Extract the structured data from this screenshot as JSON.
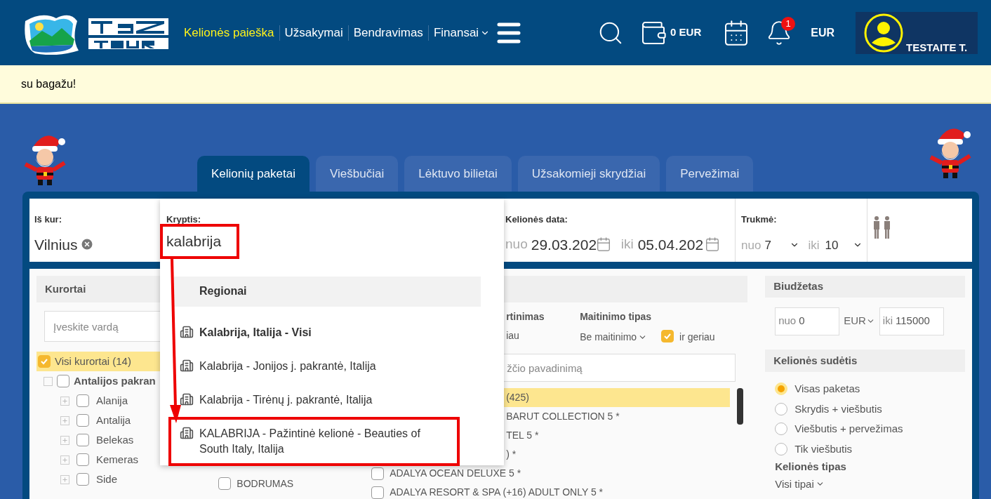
{
  "header": {
    "nav": [
      {
        "label": "Kelionės paieška",
        "selected": true,
        "has_caret": false
      },
      {
        "label": "Užsakymai",
        "selected": false,
        "has_caret": false
      },
      {
        "label": "Bendravimas",
        "selected": false,
        "has_caret": false
      },
      {
        "label": "Finansai",
        "selected": false,
        "has_caret": true
      }
    ],
    "wallet": "0 EUR",
    "notifications": "1",
    "currency": "EUR",
    "user": "TESTAITE T."
  },
  "banner": "su bagažu!",
  "tabs": [
    {
      "label": "Kelionių paketai",
      "selected": true
    },
    {
      "label": "Viešbučiai",
      "selected": false
    },
    {
      "label": "Lėktuvo bilietai",
      "selected": false
    },
    {
      "label": "Užsakomieji skrydžiai",
      "selected": false
    },
    {
      "label": "Pervežimai",
      "selected": false
    }
  ],
  "search": {
    "from": {
      "label": "Iš kur:",
      "value": "Vilnius"
    },
    "destination": {
      "label": "Kryptis:",
      "value": "kalabrija",
      "highlighted": true,
      "group": "Regionai",
      "options": [
        {
          "label": "Kalabrija, Italija - Visi",
          "emphasized": true,
          "highlighted": false
        },
        {
          "label": "Kalabrija - Jonijos j. pakrantė, Italija",
          "emphasized": false,
          "highlighted": false
        },
        {
          "label": "Kalabrija - Tirėnų j. pakrantė, Italija",
          "emphasized": false,
          "highlighted": false
        },
        {
          "label": "KALABRIJA - Pažintinė kelionė - Beauties of South Italy, Italija",
          "emphasized": false,
          "highlighted": true
        }
      ]
    },
    "dates": {
      "label": "Kelionės data:",
      "from_prefix": "nuo",
      "from": "29.03.202",
      "to_prefix": "iki",
      "to": "05.04.202"
    },
    "duration": {
      "label": "Trukmė:",
      "from_prefix": "nuo",
      "from": "7",
      "to_prefix": "iki",
      "to": "10"
    }
  },
  "filters": {
    "resorts": {
      "title": "Kurortai",
      "placeholder": "Įveskite vardą",
      "items": [
        {
          "label": "Visi kurortai (14)",
          "checked": true
        },
        {
          "label": "Antalijos pakran",
          "checked": false,
          "children": [
            {
              "label": "Alanija",
              "checked": false
            },
            {
              "label": "Antalija",
              "checked": false
            },
            {
              "label": "Belekas",
              "checked": false
            },
            {
              "label": "Kemeras",
              "checked": false
            },
            {
              "label": "Side",
              "checked": false
            }
          ]
        }
      ]
    },
    "column_2": [
      {
        "label": "BODRUMAS",
        "checked": false
      }
    ],
    "hotels": {
      "rating_label": "rtinimas",
      "rating_value": "iau",
      "meal_label": "Maitinimo tipas",
      "meal_value": "Be maitinimo",
      "better": {
        "label": "ir geriau",
        "checked": true
      },
      "placeholder": "žčio pavadinimą",
      "rows": [
        {
          "label": "(425)",
          "covered": true,
          "selected": true
        },
        {
          "label": "BARUT COLLECTION 5 *",
          "covered": true,
          "selected": false
        },
        {
          "label": "TEL 5 *",
          "covered": true,
          "selected": false
        },
        {
          "label": ") *",
          "covered": true,
          "selected": false
        },
        {
          "label": "ADALYA OCEAN DELUXE 5 *",
          "covered": false,
          "selected": false
        },
        {
          "label": "ADALYA RESORT & SPA (+16) ADULT ONLY 5 *",
          "covered": false,
          "selected": false
        }
      ]
    },
    "budget": {
      "title": "Biudžetas",
      "from_prefix": "nuo",
      "from": "0",
      "currency": "EUR",
      "to_prefix": "iki",
      "to": "115000"
    },
    "composition": {
      "title": "Kelionės sudėtis",
      "options": [
        {
          "label": "Visas paketas",
          "selected": true
        },
        {
          "label": "Skrydis + viešbutis",
          "selected": false
        },
        {
          "label": "Viešbutis + pervežimas",
          "selected": false
        },
        {
          "label": "Tik viešbutis",
          "selected": false
        }
      ]
    },
    "trip_type": {
      "title": "Kelionės tipas",
      "value": "Visi tipai"
    }
  }
}
